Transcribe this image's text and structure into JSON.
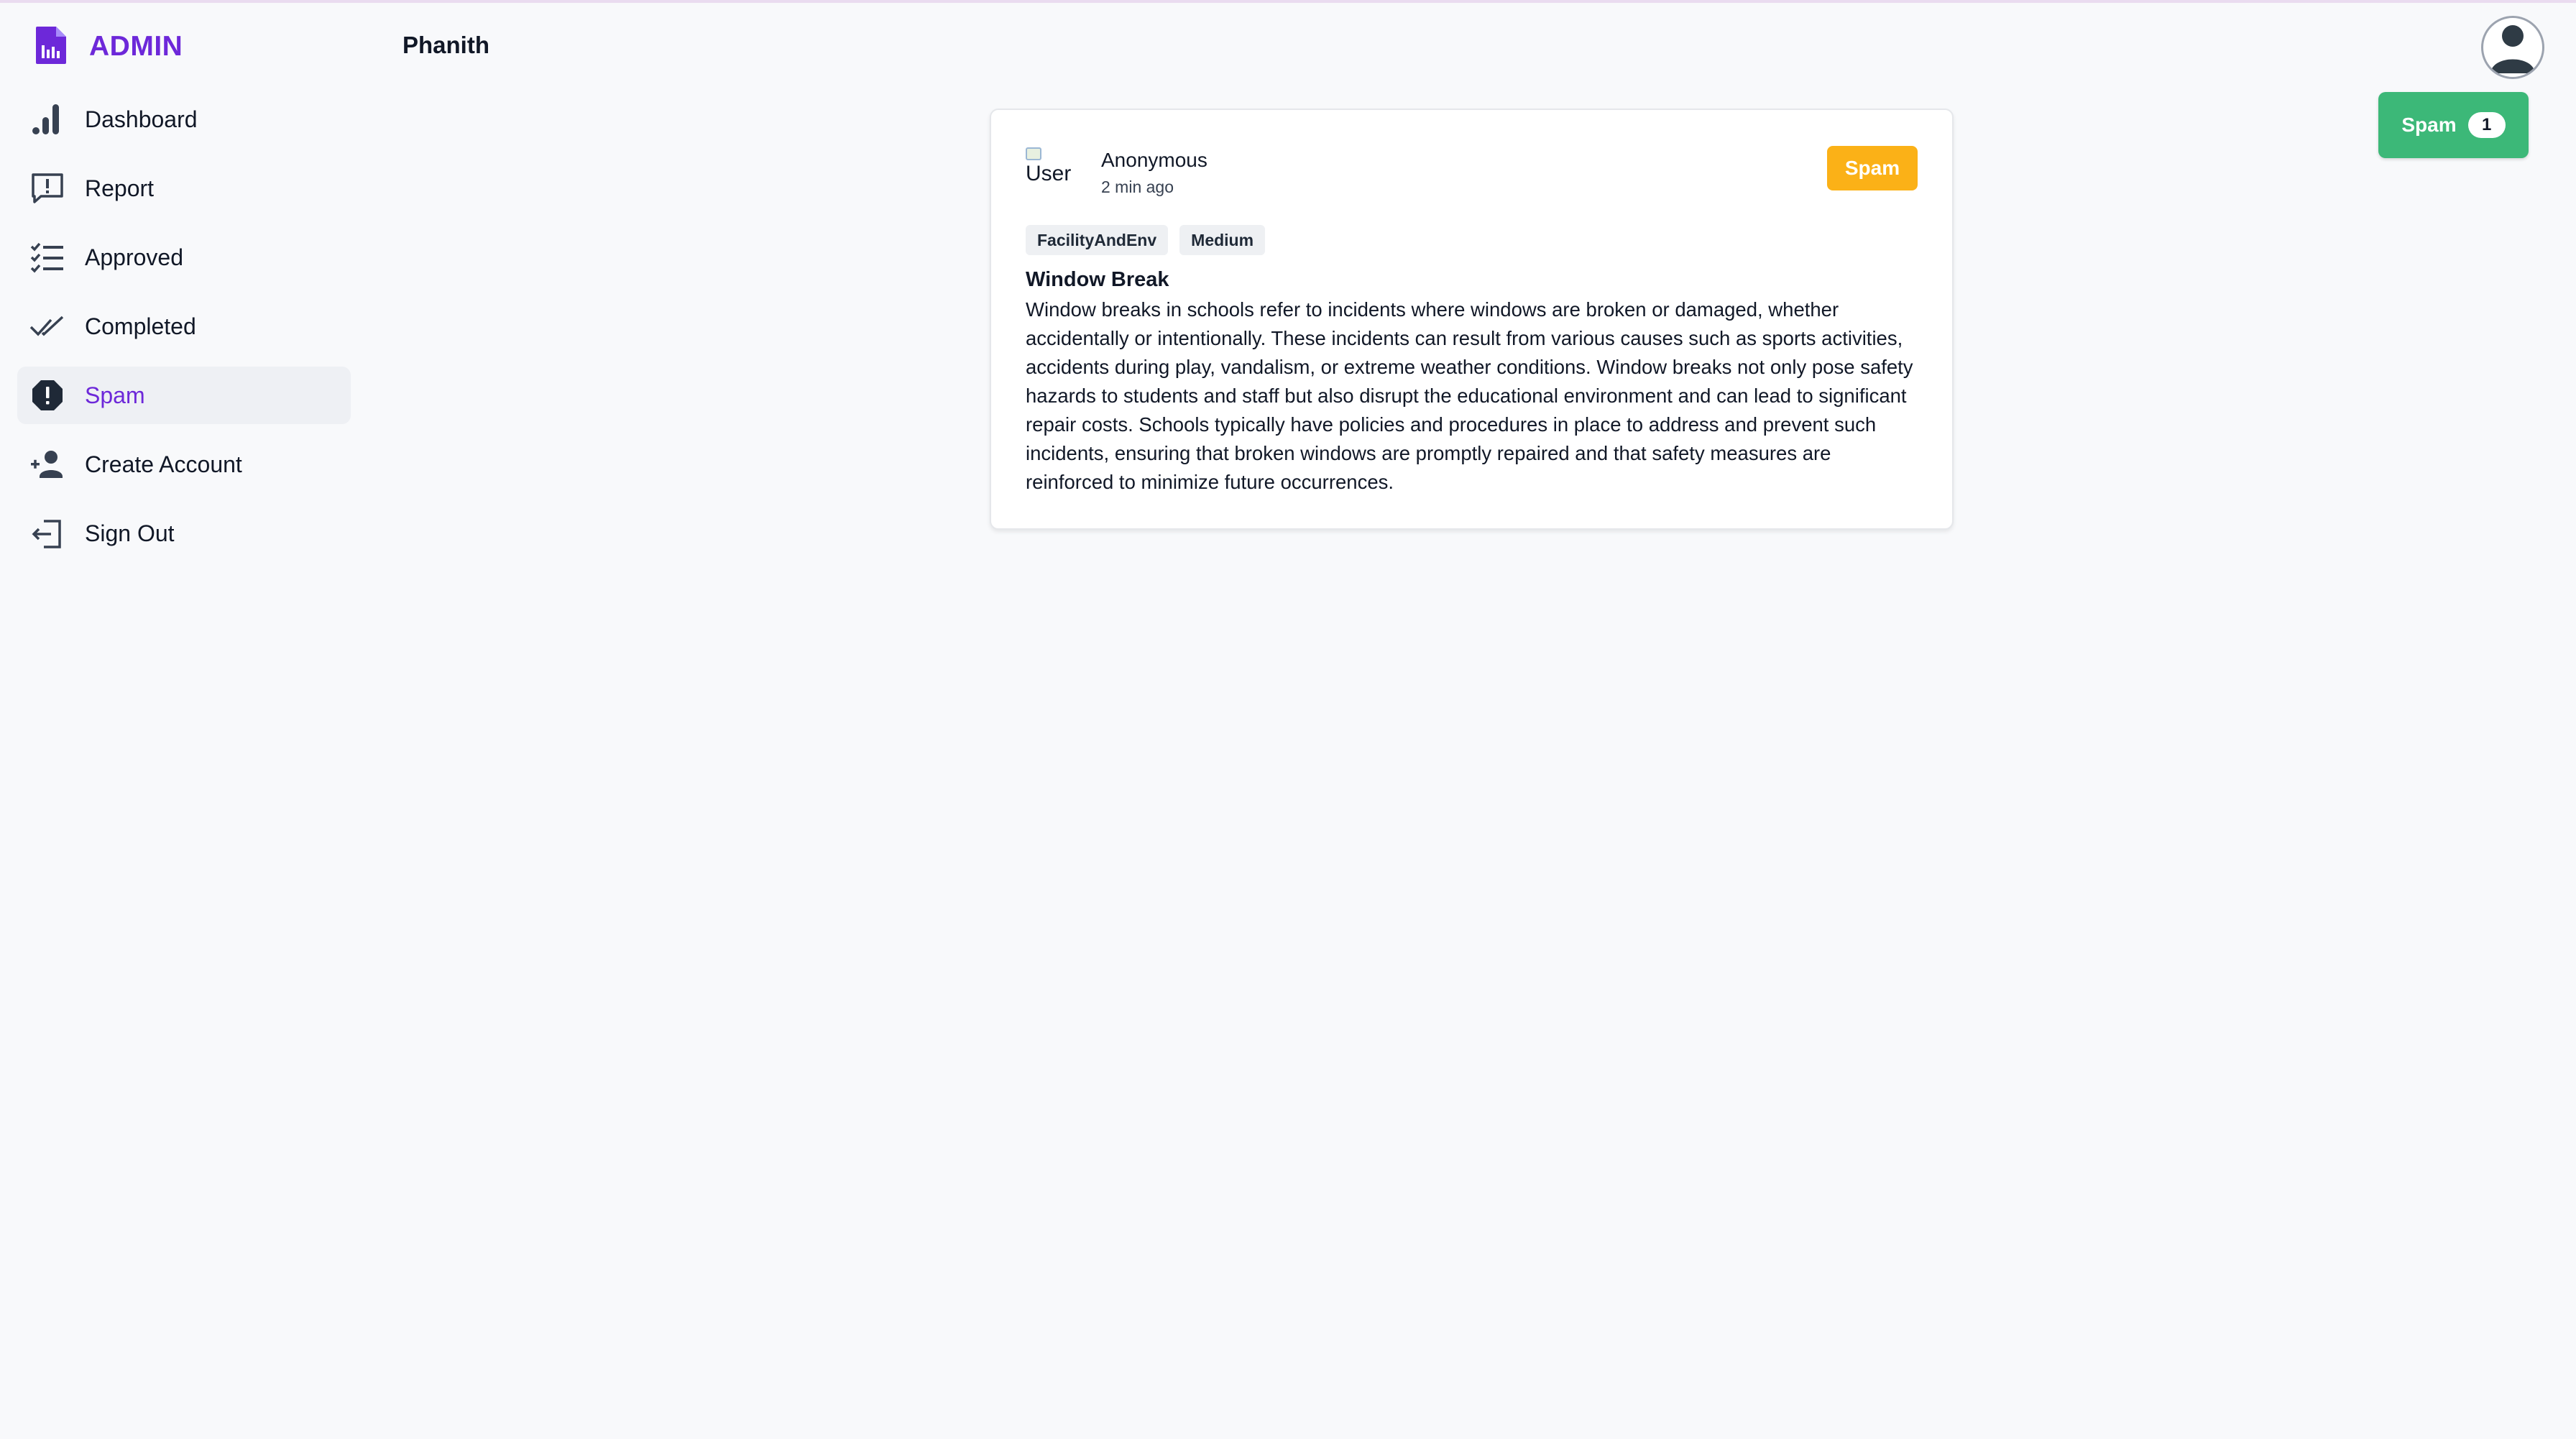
{
  "brand": {
    "name": "ADMIN"
  },
  "sidebar": {
    "items": [
      {
        "label": "Dashboard",
        "icon": "bar-chart-icon",
        "active": false
      },
      {
        "label": "Report",
        "icon": "report-message-icon",
        "active": false
      },
      {
        "label": "Approved",
        "icon": "checklist-icon",
        "active": false
      },
      {
        "label": "Completed",
        "icon": "double-check-icon",
        "active": false
      },
      {
        "label": "Spam",
        "icon": "spam-alert-icon",
        "active": true
      },
      {
        "label": "Create Account",
        "icon": "add-user-icon",
        "active": false
      },
      {
        "label": "Sign Out",
        "icon": "sign-out-icon",
        "active": false
      }
    ]
  },
  "header": {
    "user_name": "Phanith",
    "avatar_icon": "user-avatar-icon"
  },
  "spam_counter": {
    "label": "Spam",
    "count": "1"
  },
  "report": {
    "reporter_image_alt": "User",
    "reporter_name": "Anonymous",
    "time": "2 min ago",
    "status": "Spam",
    "tags": [
      "FacilityAndEnv",
      "Medium"
    ],
    "title": "Window Break",
    "description": "Window breaks in schools refer to incidents where windows are broken or damaged, whether accidentally or intentionally. These incidents can result from various causes such as sports activities, accidents during play, vandalism, or extreme weather conditions. Window breaks not only pose safety hazards to students and staff but also disrupt the educational environment and can lead to significant repair costs. Schools typically have policies and procedures in place to address and prevent such incidents, ensuring that broken windows are promptly repaired and that safety measures are reinforced to minimize future occurrences."
  },
  "colors": {
    "brand": "#6d28d9",
    "active_bg": "#eef0f4",
    "spam_badge": "#fbb117",
    "spam_counter": "#3cb878",
    "background": "#f8f9fb"
  }
}
